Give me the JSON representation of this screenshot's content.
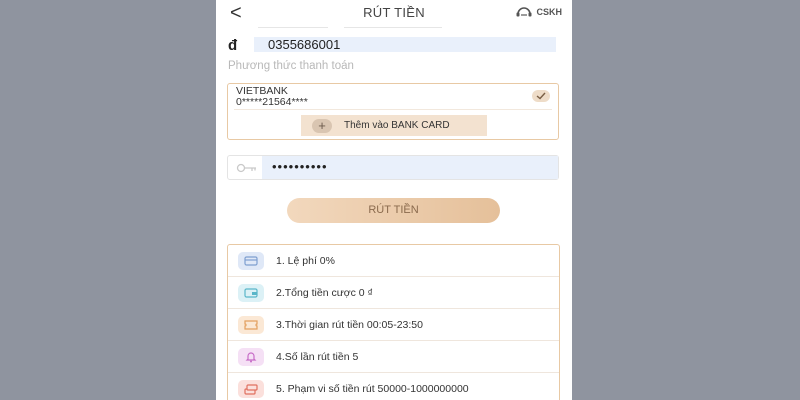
{
  "header": {
    "back_glyph": "<",
    "title": "RÚT TIỀN",
    "support_label": "CSKH"
  },
  "account": {
    "currency_symbol": "đ",
    "number": "0355686001"
  },
  "payment": {
    "label": "Phương thức thanh toán",
    "bank_name": "VIETBANK",
    "bank_account": "0*****21564****",
    "add_card_label": "Thêm vào BANK CARD"
  },
  "password": {
    "masked_value": "••••••••••"
  },
  "submit_label": "RÚT TIỀN",
  "info_items": [
    {
      "text": "1. Lệ phí 0%",
      "icon": "card-icon",
      "color": "#dfe8f7",
      "icon_color": "#7e9fd0"
    },
    {
      "text": "2.Tổng tiền cược 0 ₫",
      "icon": "wallet-icon",
      "color": "#dcf1f6",
      "icon_color": "#59b6c9"
    },
    {
      "text": "3.Thời gian rút tiền 00:05-23:50",
      "icon": "ticket-icon",
      "color": "#fbe8d5",
      "icon_color": "#e3a060"
    },
    {
      "text": "4.Số lần rút tiền 5",
      "icon": "bell-icon",
      "color": "#f5e0f5",
      "icon_color": "#c76bc7"
    },
    {
      "text": "5. Phạm vi số tiền rút 50000-1000000000",
      "icon": "money-stack-icon",
      "color": "#fbe0dc",
      "icon_color": "#e0705f"
    }
  ]
}
